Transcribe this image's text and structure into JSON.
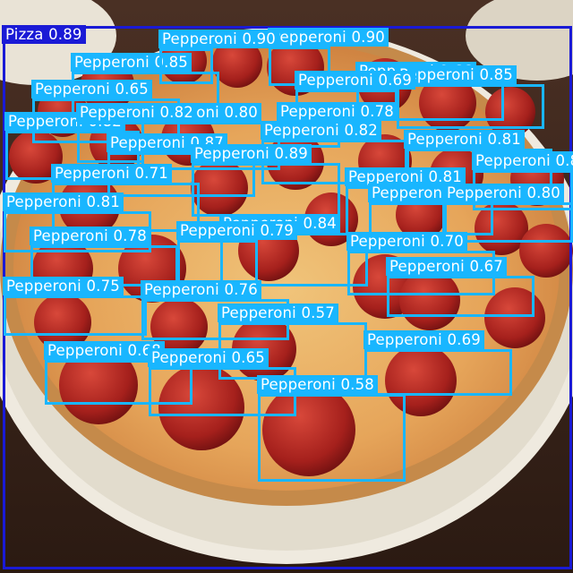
{
  "colors": {
    "pepperoni": "#19b6ff",
    "pizza": "#1a1ad6",
    "label_text": "#ffffff"
  },
  "detections": [
    {
      "name": "pizza-detection",
      "label": "Pizza",
      "score": "0.89",
      "cls": "pizza"
    },
    {
      "name": "pepperoni-detection",
      "label": "Pepperoni",
      "score": "0.90",
      "cls": "pepperoni"
    },
    {
      "name": "pepperoni-detection",
      "label": "Pepperoni",
      "score": "0.85",
      "cls": "pepperoni"
    },
    {
      "name": "pepperoni-detection",
      "label": "Pepperoni",
      "score": "0.66",
      "cls": "pepperoni"
    },
    {
      "name": "pepperoni-detection",
      "label": "Pepperoni",
      "score": "0.85",
      "cls": "pepperoni"
    },
    {
      "name": "pepperoni-detection",
      "label": "Pepperoni",
      "score": "0.90",
      "cls": "pepperoni"
    },
    {
      "name": "pepperoni-detection",
      "label": "Pepperoni",
      "score": "0.69",
      "cls": "pepperoni"
    },
    {
      "name": "pepperoni-detection",
      "label": "Pepperoni",
      "score": "0.65",
      "cls": "pepperoni"
    },
    {
      "name": "pepperoni-detection",
      "label": "Pepperoni",
      "score": "0.82",
      "cls": "pepperoni"
    },
    {
      "name": "pepperoni-detection",
      "label": "Pepperoni",
      "score": "0.80",
      "cls": "pepperoni"
    },
    {
      "name": "pepperoni-detection",
      "label": "Pepperoni",
      "score": "0.78",
      "cls": "pepperoni"
    },
    {
      "name": "pepperoni-detection",
      "label": "Pepperoni",
      "score": "0.82",
      "cls": "pepperoni"
    },
    {
      "name": "pepperoni-detection",
      "label": "Pepperoni",
      "score": "0.82",
      "cls": "pepperoni"
    },
    {
      "name": "pepperoni-detection",
      "label": "Pepperoni",
      "score": "0.87",
      "cls": "pepperoni"
    },
    {
      "name": "pepperoni-detection",
      "label": "Pepperoni",
      "score": "0.81",
      "cls": "pepperoni"
    },
    {
      "name": "pepperoni-detection",
      "label": "Pepperoni",
      "score": "0.89",
      "cls": "pepperoni"
    },
    {
      "name": "pepperoni-detection",
      "label": "Pepperoni",
      "score": "0.71",
      "cls": "pepperoni"
    },
    {
      "name": "pepperoni-detection",
      "label": "Pepperoni",
      "score": "0.81",
      "cls": "pepperoni"
    },
    {
      "name": "pepperoni-detection",
      "label": "Pepperoni",
      "score": "0.80",
      "cls": "pepperoni"
    },
    {
      "name": "pepperoni-detection",
      "label": "Pepperoni",
      "score": "0.81",
      "cls": "pepperoni"
    },
    {
      "name": "pepperoni-detection",
      "label": "Pepperoni",
      "score": "0.84",
      "cls": "pepperoni"
    },
    {
      "name": "pepperoni-detection",
      "label": "Pepperoni",
      "score": "0.89",
      "cls": "pepperoni"
    },
    {
      "name": "pepperoni-detection",
      "label": "Pepperoni",
      "score": "0.80",
      "cls": "pepperoni"
    },
    {
      "name": "pepperoni-detection",
      "label": "Pepperoni",
      "score": "0.78",
      "cls": "pepperoni"
    },
    {
      "name": "pepperoni-detection",
      "label": "Pepperoni",
      "score": "0.79",
      "cls": "pepperoni"
    },
    {
      "name": "pepperoni-detection",
      "label": "Pepperoni",
      "score": "0.70",
      "cls": "pepperoni"
    },
    {
      "name": "pepperoni-detection",
      "label": "Pepperoni",
      "score": "0.67",
      "cls": "pepperoni"
    },
    {
      "name": "pepperoni-detection",
      "label": "Pepperoni",
      "score": "0.75",
      "cls": "pepperoni"
    },
    {
      "name": "pepperoni-detection",
      "label": "Pepperoni",
      "score": "0.76",
      "cls": "pepperoni"
    },
    {
      "name": "pepperoni-detection",
      "label": "Pepperoni",
      "score": "0.57",
      "cls": "pepperoni"
    },
    {
      "name": "pepperoni-detection",
      "label": "Pepperoni",
      "score": "0.68",
      "cls": "pepperoni"
    },
    {
      "name": "pepperoni-detection",
      "label": "Pepperoni",
      "score": "0.65",
      "cls": "pepperoni"
    },
    {
      "name": "pepperoni-detection",
      "label": "Pepperoni",
      "score": "0.69",
      "cls": "pepperoni"
    },
    {
      "name": "pepperoni-detection",
      "label": "Pepperoni",
      "score": "0.58",
      "cls": "pepperoni"
    },
    {
      "name": "pepperoni-detection",
      "label": "Pepperoni",
      "score": "0.65",
      "cls": "pepperoni"
    }
  ]
}
